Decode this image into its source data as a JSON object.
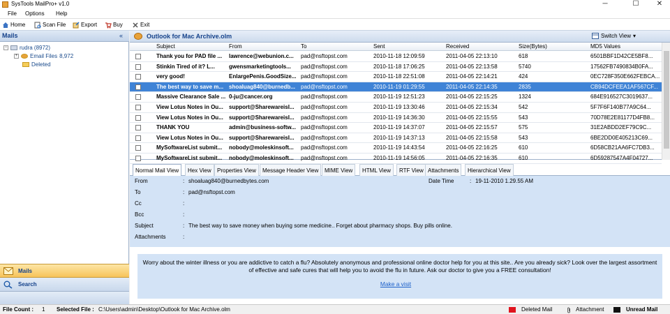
{
  "window": {
    "title": "SysTools MailPro+ v1.0",
    "minimize": "─",
    "maximize": "☐",
    "close": "✕"
  },
  "menu": [
    "File",
    "Options",
    "Help"
  ],
  "toolbar": [
    {
      "label": "Home",
      "icon": "home-icon"
    },
    {
      "label": "Scan File",
      "icon": "scan-file-icon"
    },
    {
      "label": "Export",
      "icon": "export-icon"
    },
    {
      "label": "Buy",
      "icon": "cart-icon"
    },
    {
      "label": "Exit",
      "icon": "exit-icon"
    }
  ],
  "left": {
    "title": "Mails",
    "collapse": "«",
    "tree": {
      "root": "rudra (8972)",
      "children": [
        {
          "label": "Email Files",
          "count": "8,972"
        },
        {
          "label": "Deleted"
        }
      ]
    },
    "nav": {
      "mails": "Mails",
      "search": "Search"
    }
  },
  "archive": {
    "title": "Outlook for Mac Archive.olm",
    "switch_view": "Switch View",
    "columns": [
      "Subject",
      "From",
      "To",
      "Sent",
      "Received",
      "Size(Bytes)",
      "MD5 Values"
    ],
    "rows": [
      {
        "subject": "Thank you for PAD file ...",
        "from": "lawrence@webunion.c...",
        "to": "pad@nsftopst.com",
        "sent": "2010-11-18 12:09:59",
        "received": "2011-04-05 22:13:10",
        "size": "618",
        "md5": "6501BBF1D42CE5BF8..."
      },
      {
        "subject": "Stinkin Tired of it? L...",
        "from": "gwensmarketingtools...",
        "to": "pad@nsftopst.com",
        "sent": "2010-11-18 17:06:25",
        "received": "2011-04-05 22:13:58",
        "size": "5740",
        "md5": "17562FB7490834B0FA..."
      },
      {
        "subject": "very good!",
        "from": "EnlargePenis.GoodSize...",
        "to": "pad@nsftopst.com",
        "sent": "2010-11-18 22:51:08",
        "received": "2011-04-05 22:14:21",
        "size": "424",
        "md5": "0EC728F350E662FEBCA..."
      },
      {
        "subject": "The best way to save m...",
        "from": "shoaluag840@burnedb...",
        "to": "pad@nsftopst.com",
        "sent": "2010-11-19 01:29:55",
        "received": "2011-04-05 22:14:35",
        "size": "2835",
        "md5": "CB94DCFEEA1AF567CF...",
        "selected": true
      },
      {
        "subject": "Massive Clearance Sale ...",
        "from": "0-ju@cancer.org",
        "to": "pad@nsftopst.com",
        "sent": "2010-11-19 12:51:23",
        "received": "2011-04-05 22:15:25",
        "size": "1324",
        "md5": "684E916527C3019637..."
      },
      {
        "subject": "View Lotus Notes in Ou...",
        "from": "support@SharewareisI...",
        "to": "pad@nsftopst.com",
        "sent": "2010-11-19 13:30:46",
        "received": "2011-04-05 22:15:34",
        "size": "542",
        "md5": "5F7F6F140B77A9C64..."
      },
      {
        "subject": "View Lotus Notes in Ou...",
        "from": "support@SharewareisI...",
        "to": "pad@nsftopst.com",
        "sent": "2010-11-19 14:36:30",
        "received": "2011-04-05 22:15:55",
        "size": "543",
        "md5": "70D78E2E81177D4FB8..."
      },
      {
        "subject": "THANK YOU",
        "from": "admin@business-softw...",
        "to": "pad@nsftopst.com",
        "sent": "2010-11-19 14:37:07",
        "received": "2011-04-05 22:15:57",
        "size": "575",
        "md5": "31E2ABDD2EF79C9C..."
      },
      {
        "subject": "View Lotus Notes in Ou...",
        "from": "support@SharewareisI...",
        "to": "pad@nsftopst.com",
        "sent": "2010-11-19 14:37:13",
        "received": "2011-04-05 22:15:58",
        "size": "543",
        "md5": "6BE2DD0E405213C69..."
      },
      {
        "subject": "MySoftwareList submit...",
        "from": "nobody@moleskinsoft...",
        "to": "pad@nsftopst.com",
        "sent": "2010-11-19 14:43:54",
        "received": "2011-04-05 22:16:25",
        "size": "610",
        "md5": "6D58CB21AA6FC7DB3..."
      },
      {
        "subject": "MySoftwareList submit...",
        "from": "nobody@moleskinsoft...",
        "to": "pad@nsftopst.com",
        "sent": "2010-11-19 14:56:05",
        "received": "2011-04-05 22:16:35",
        "size": "610",
        "md5": "6D59287547A4F04727..."
      }
    ]
  },
  "tabs": [
    "Normal Mail View",
    "Hex View",
    "Properties View",
    "Message Header View",
    "MIME View",
    "HTML View",
    "RTF View",
    "Attachments",
    "Hierarchical View"
  ],
  "details": {
    "from_label": "From",
    "from_value": "shoaluag840@burnedbytes.com",
    "date_label": "Date Time",
    "date_value": "19-11-2010 1.29.55 AM",
    "to_label": "To",
    "to_value": "pad@nsftopst.com",
    "cc_label": "Cc",
    "bcc_label": "Bcc",
    "subject_label": "Subject",
    "subject_value": "The best way to save money when buying some medicine.. Forget about pharmacy shops. Buy pills online.",
    "attachments_label": "Attachments",
    "colon": ":"
  },
  "body": {
    "text": "Worry about the winter illness or you are addictive to catch a flu? Absolutely anonymous and professional online doctor help for you at this site.. Are you already sick? Look over the largest assortment of effective and safe cures that will help you to avoid the flu in future. Ask our doctor to give you a FREE consultation!",
    "link": "Make a visit"
  },
  "status": {
    "file_count_label": "File Count :",
    "file_count": "1",
    "selected_label": "Selected File :",
    "selected_path": "C:\\Users\\admin\\Desktop\\Outlook for Mac Archive.olm",
    "legend_deleted": "Deleted Mail",
    "legend_attachment": "Attachment",
    "legend_unread": "Unread Mail",
    "deleted_color": "#e0141e",
    "unread_color": "#111111"
  }
}
